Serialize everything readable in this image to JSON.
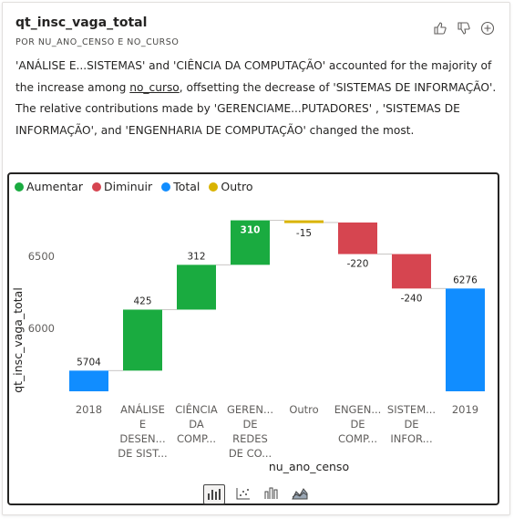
{
  "card": {
    "title": "qt_insc_vaga_total",
    "subtitle": "POR NU_ANO_CENSO E NO_CURSO",
    "summary_parts": {
      "p1": "'ANÁLISE E...SISTEMAS' and 'CIÊNCIA DA COMPUTAÇÃO' accounted for the majority of the increase among ",
      "link": "no_curso",
      "p2": ", offsetting the decrease of 'SISTEMAS DE INFORMAÇÃO'. The relative contributions made by 'GERENCIAME...PUTADORES' , 'SISTEMAS DE INFORMAÇÃO', and 'ENGENHARIA DE COMPUTAÇÃO' changed the most."
    },
    "actions": [
      "thumbs-up-icon",
      "thumbs-down-icon",
      "add-icon"
    ]
  },
  "colors": {
    "increase": "#1aab40",
    "decrease": "#d64550",
    "total": "#118dff",
    "other": "#d9b300"
  },
  "chart_data": {
    "type": "waterfall",
    "legend": [
      {
        "label": "Aumentar",
        "color": "#1aab40"
      },
      {
        "label": "Diminuir",
        "color": "#d64550"
      },
      {
        "label": "Total",
        "color": "#118dff"
      },
      {
        "label": "Outro",
        "color": "#d9b300"
      }
    ],
    "xlabel": "nu_ano_censo",
    "ylabel": "qt_insc_vaga_total",
    "yticks": [
      6000,
      6500
    ],
    "ylim": [
      5560,
      6780
    ],
    "bars": [
      {
        "lines": [
          "2018"
        ],
        "kind": "total",
        "value": 5704,
        "label": "5704"
      },
      {
        "lines": [
          "ANÁLISE",
          "E",
          "DESEN...",
          "DE SIST..."
        ],
        "kind": "increase",
        "value": 425,
        "label": "425"
      },
      {
        "lines": [
          "CIÊNCIA",
          "DA",
          "COMP..."
        ],
        "kind": "increase",
        "value": 312,
        "label": "312"
      },
      {
        "lines": [
          "GEREN...",
          "DE",
          "REDES",
          "DE CO..."
        ],
        "kind": "increase",
        "value": 310,
        "label": "310"
      },
      {
        "lines": [
          "Outro"
        ],
        "kind": "other",
        "value": -15,
        "label": "-15"
      },
      {
        "lines": [
          "ENGEN...",
          "DE",
          "COMP..."
        ],
        "kind": "decrease",
        "value": -220,
        "label": "-220"
      },
      {
        "lines": [
          "SISTEM...",
          "DE",
          "INFOR..."
        ],
        "kind": "decrease",
        "value": -240,
        "label": "-240"
      },
      {
        "lines": [
          "2019"
        ],
        "kind": "total",
        "value": 6276,
        "label": "6276"
      }
    ]
  },
  "viz_switch": [
    "waterfall-icon",
    "scatter-icon",
    "column-icon",
    "area-icon"
  ]
}
